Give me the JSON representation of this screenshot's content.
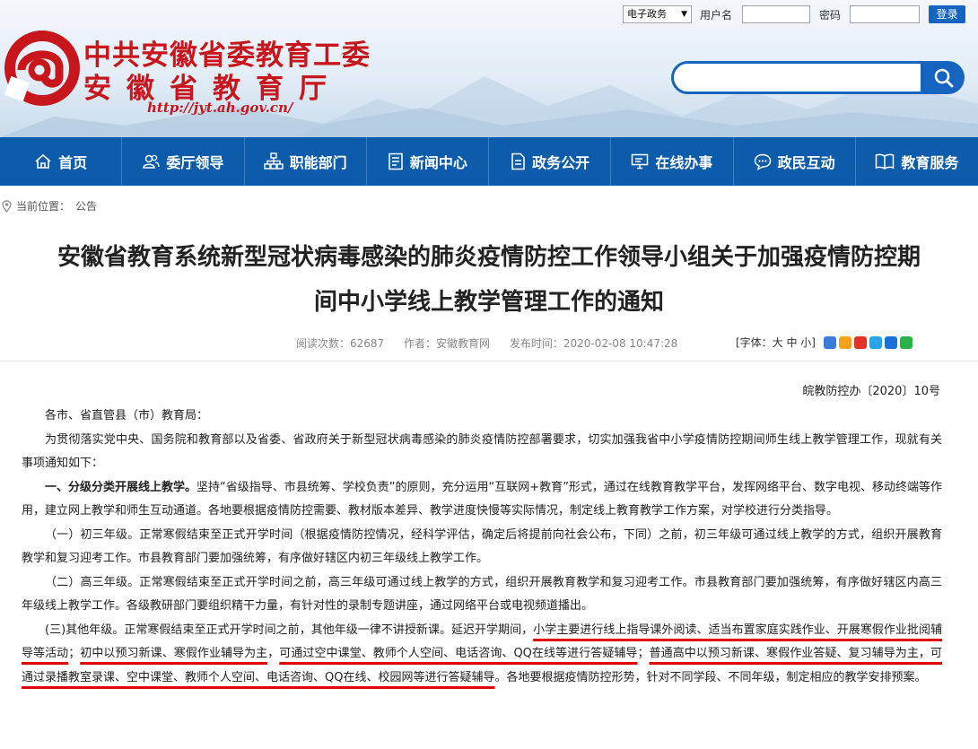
{
  "header": {
    "title_line1": "中共安徽省委教育工委",
    "title_line2": "安徽省教育厅",
    "url": "http://jyt.ah.gov.cn/",
    "login": {
      "select_value": "电子政务",
      "username_label": "用户名",
      "password_label": "密码",
      "login_button": "登录"
    }
  },
  "nav": {
    "items": [
      {
        "label": "首页",
        "icon": "home-icon"
      },
      {
        "label": "委厅领导",
        "icon": "leaders-icon"
      },
      {
        "label": "职能部门",
        "icon": "org-chart-icon"
      },
      {
        "label": "新闻中心",
        "icon": "news-icon"
      },
      {
        "label": "政务公开",
        "icon": "document-icon"
      },
      {
        "label": "在线办事",
        "icon": "monitor-icon"
      },
      {
        "label": "政民互动",
        "icon": "chat-icon"
      },
      {
        "label": "教育服务",
        "icon": "book-icon"
      }
    ]
  },
  "breadcrumb": {
    "label": "当前位置：",
    "current": "公告"
  },
  "article": {
    "title_line1": "安徽省教育系统新型冠状病毒感染的肺炎疫情防控工作领导小组关于加强疫情防控期",
    "title_line2": "间中小学线上教学管理工作的通知",
    "meta": {
      "reads": "阅读次数：62687",
      "author": "作者：安徽教育网",
      "time": "发布时间：2020-02-08 10:47:28"
    },
    "font_tool": "[字体：大 中 小]",
    "doc_no": "皖教防控办〔2020〕10号",
    "salutation": "各市、省直管县（市）教育局：",
    "p1": "为贯彻落实党中央、国务院和教育部以及省委、省政府关于新型冠状病毒感染的肺炎疫情防控部署要求，切实加强我省中小学疫情防控期间师生线上教学管理工作，现就有关事项通知如下：",
    "p2_lead": "一、分级分类开展线上教学。",
    "p2_rest": "坚持“省级指导、市县统筹、学校负责”的原则，充分运用“互联网+教育”形式，通过在线教育教学平台，发挥网络平台、数字电视、移动终端等作用，建立网上教学和师生互动通道。各地要根据疫情防控需要、教材版本差异、教学进度快慢等实际情况，制定线上教育教学工作方案，对学校进行分类指导。",
    "p3": "（一）初三年级。正常寒假结束至正式开学时间（根据疫情防控情况，经科学评估，确定后将提前向社会公布，下同）之前，初三年级可通过线上教学的方式，组织开展教育教学和复习迎考工作。市县教育部门要加强统筹，有序做好辖区内初三年级线上教学工作。",
    "p4": "（二）高三年级。正常寒假结束至正式开学时间之前，高三年级可通过线上教学的方式，组织开展教育教学和复习迎考工作。市县教育部门要加强统筹，有序做好辖区内高三年级线上教学工作。各级教研部门要组织精干力量，有针对性的录制专题讲座，通过网络平台或电视频道播出。",
    "p5_a": "(三)其他年级。正常寒假结束至正式开学时间之前，其他年级一律不讲授新课。延迟开学期间，",
    "p5_u1": "小学主要进行线上指导课外阅读、适当布置家庭实践作业、开展寒假作业批阅辅导等活动",
    "p5_b": "；",
    "p5_u2": "初中以预习新课、寒假作业辅导为主",
    "p5_c": "，",
    "p5_u3": "可通过空中课堂、教师个人空间、电话咨询、QQ在线等进行答疑辅导",
    "p5_d": "；",
    "p5_u4": "普通高中以预习新课、寒假作业答疑、复习辅导为主，可通过录播教室录课、空中课堂、教师个人空间、电话咨询、QQ在线、校园网等进行答疑辅导",
    "p5_e": "。各地要根据疫情防控形势，针对不同学段、不同年级，制定相应的教学安排预案。"
  },
  "colors": {
    "brand_red": "#c8161d",
    "nav_blue": "#0d5cab",
    "button_blue": "#1565c0",
    "underline_red": "#e00000"
  }
}
